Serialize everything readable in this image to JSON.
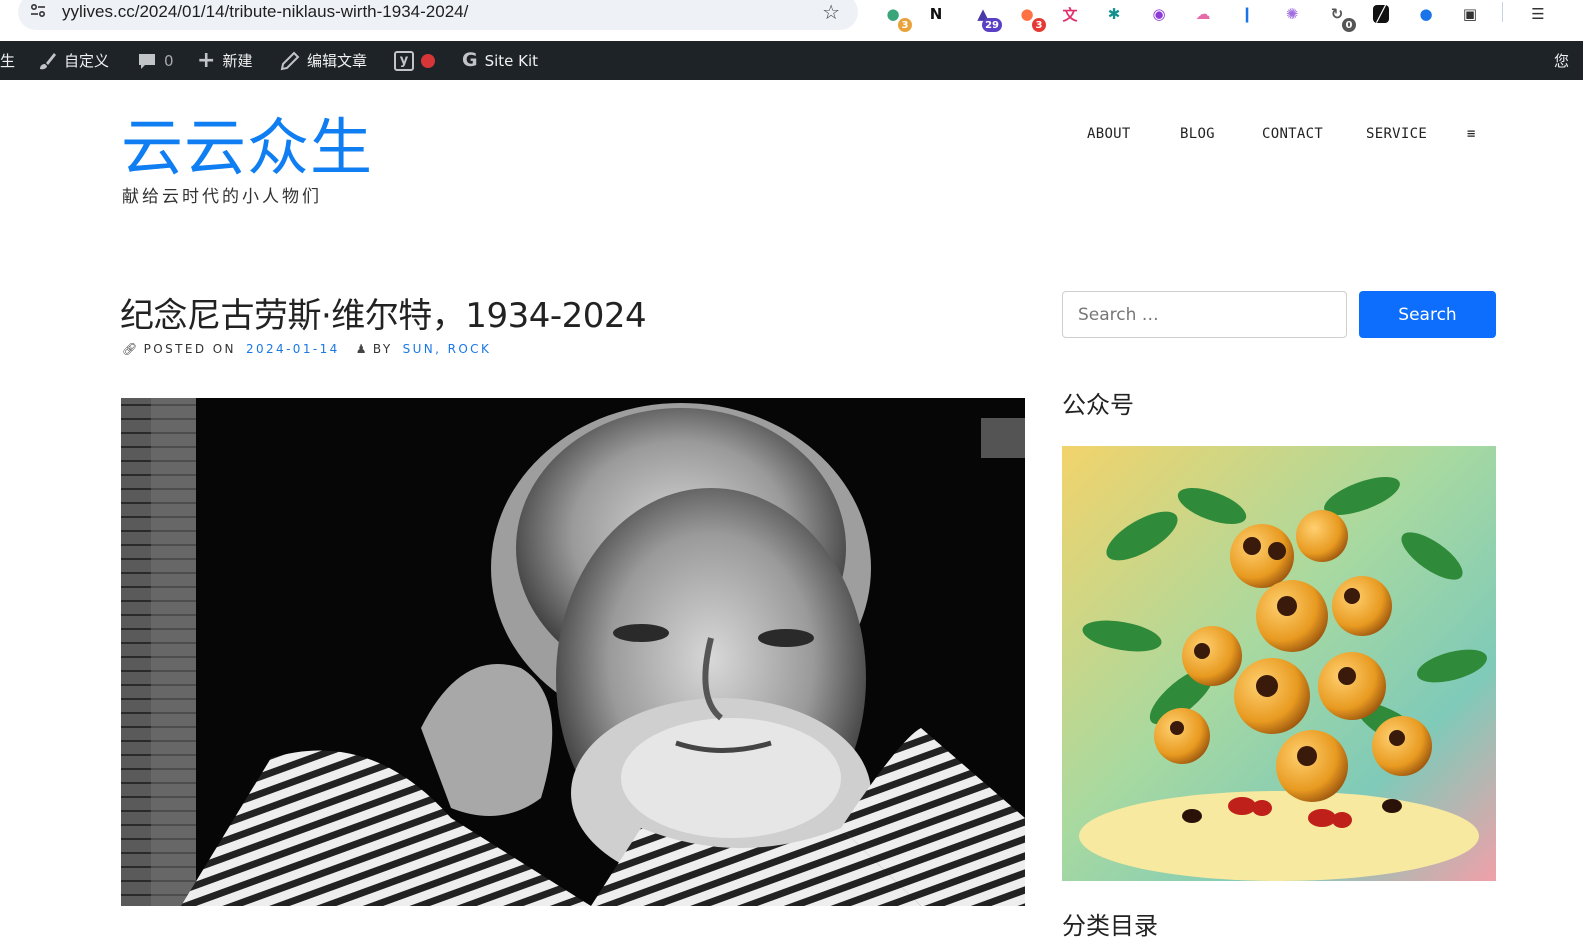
{
  "browser": {
    "url": "yylives.cc/2024/01/14/tribute-niklaus-wirth-1934-2024/",
    "extensions": [
      {
        "icon": "chatgpt-ext-icon",
        "badge": "3",
        "badge_color": "#e8a33d"
      },
      {
        "icon": "notion-icon",
        "badge": ""
      },
      {
        "icon": "graduation-cap-icon",
        "badge": "29",
        "badge_color": "#5b3fc4"
      },
      {
        "icon": "circles-icon",
        "badge": "3",
        "badge_color": "#e53935"
      },
      {
        "icon": "translate-icon",
        "badge": ""
      },
      {
        "icon": "grid-ext-icon",
        "badge": ""
      },
      {
        "icon": "lp-icon",
        "badge": ""
      },
      {
        "icon": "cloud-ext-icon",
        "badge": ""
      },
      {
        "icon": "feather-icon",
        "badge": ""
      },
      {
        "icon": "openai-icon",
        "badge": ""
      },
      {
        "icon": "refresh-ext-icon",
        "badge": "0",
        "badge_color": "#555555"
      },
      {
        "icon": "slash-ext-icon",
        "badge": ""
      },
      {
        "icon": "g-circle-icon",
        "badge": ""
      },
      {
        "icon": "puzzle-icon",
        "badge": ""
      },
      {
        "icon": "reading-list-icon",
        "badge": ""
      }
    ]
  },
  "adminbar": {
    "site_fragment": "生",
    "customize": "自定义",
    "comments_count": "0",
    "new": "新建",
    "edit_post": "编辑文章",
    "sitekit": "Site Kit",
    "howdy_fragment": "您"
  },
  "site": {
    "title": "云云众生",
    "tagline": "献给云时代的小人物们",
    "nav": [
      "ABOUT",
      "BLOG",
      "CONTACT",
      "SERVICE",
      "≡"
    ]
  },
  "post": {
    "title": "纪念尼古劳斯·维尔特，1934-2024",
    "posted_on_label": "POSTED ON",
    "date": "2024-01-14",
    "by_label": "BY",
    "author": "SUN, ROCK"
  },
  "sidebar": {
    "search_placeholder": "Search …",
    "search_button": "Search",
    "widget1_title": "公众号",
    "widget2_title": "分类目录"
  },
  "colors": {
    "accent": "#0f7ef2",
    "button": "#0d6efd",
    "adminbar": "#1d2327",
    "link": "#1a78e5"
  }
}
